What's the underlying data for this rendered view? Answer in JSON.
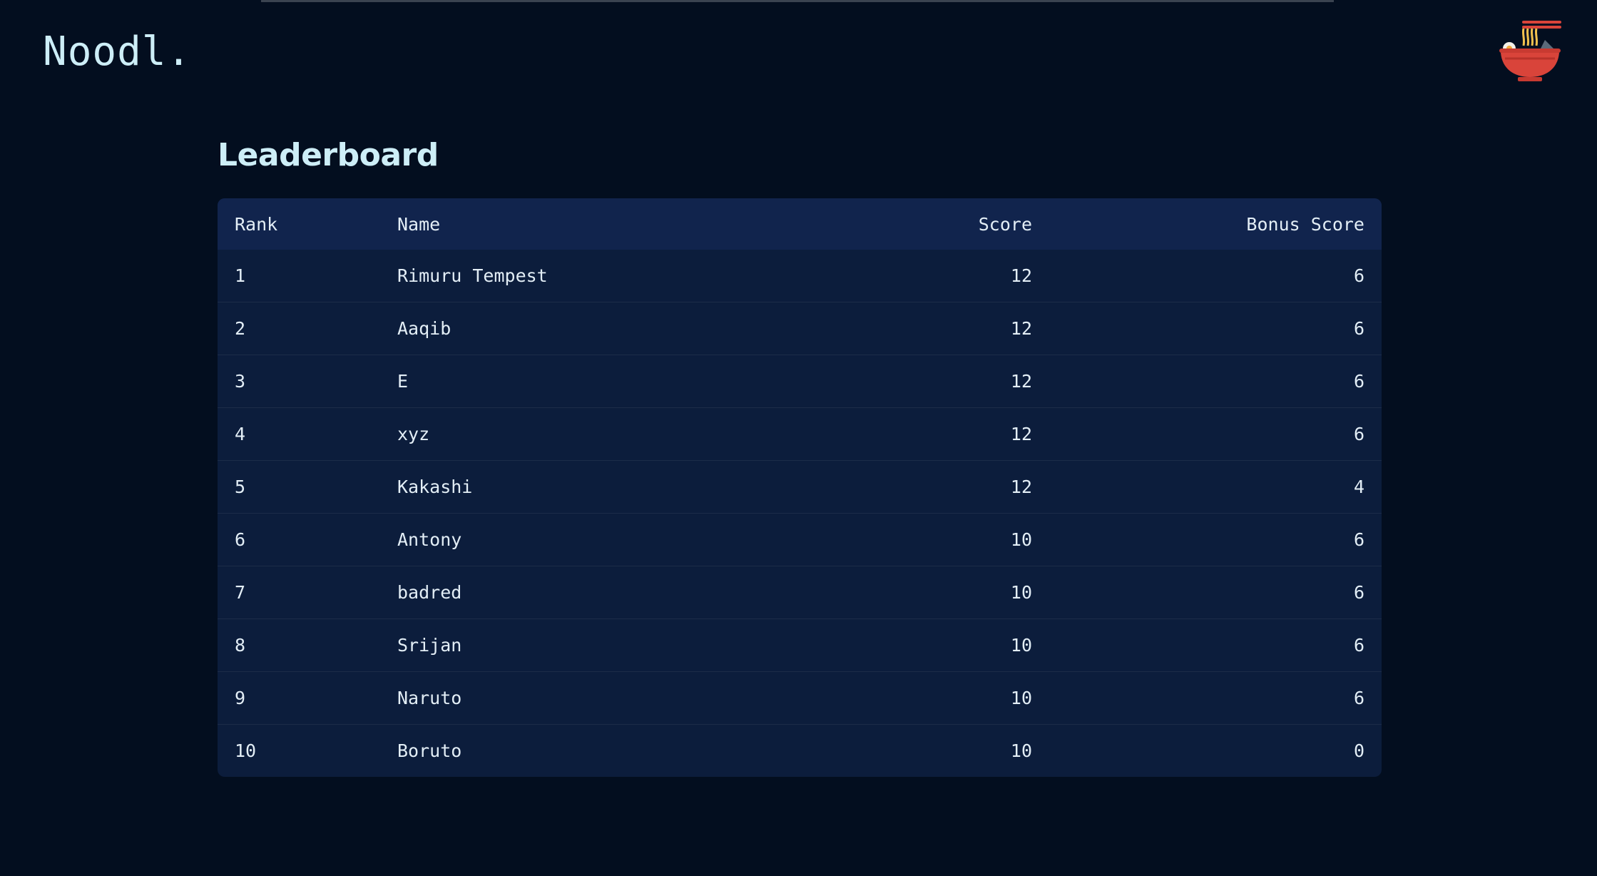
{
  "brand": "Noodl.",
  "page_title": "Leaderboard",
  "icons": {
    "logo": "noodle-bowl-icon"
  },
  "colors": {
    "background": "#030e1f",
    "table_bg": "#0c1d3c",
    "header_bg": "#11244d",
    "bowl_red": "#d9443a"
  },
  "table": {
    "headers": {
      "rank": "Rank",
      "name": "Name",
      "score": "Score",
      "bonus": "Bonus Score"
    },
    "rows": [
      {
        "rank": "1",
        "name": "Rimuru Tempest",
        "score": "12",
        "bonus": "6"
      },
      {
        "rank": "2",
        "name": "Aaqib",
        "score": "12",
        "bonus": "6"
      },
      {
        "rank": "3",
        "name": "E",
        "score": "12",
        "bonus": "6"
      },
      {
        "rank": "4",
        "name": "xyz",
        "score": "12",
        "bonus": "6"
      },
      {
        "rank": "5",
        "name": "Kakashi",
        "score": "12",
        "bonus": "4"
      },
      {
        "rank": "6",
        "name": "Antony",
        "score": "10",
        "bonus": "6"
      },
      {
        "rank": "7",
        "name": "badred",
        "score": "10",
        "bonus": "6"
      },
      {
        "rank": "8",
        "name": "Srijan",
        "score": "10",
        "bonus": "6"
      },
      {
        "rank": "9",
        "name": "Naruto",
        "score": "10",
        "bonus": "6"
      },
      {
        "rank": "10",
        "name": "Boruto",
        "score": "10",
        "bonus": "0"
      }
    ]
  }
}
